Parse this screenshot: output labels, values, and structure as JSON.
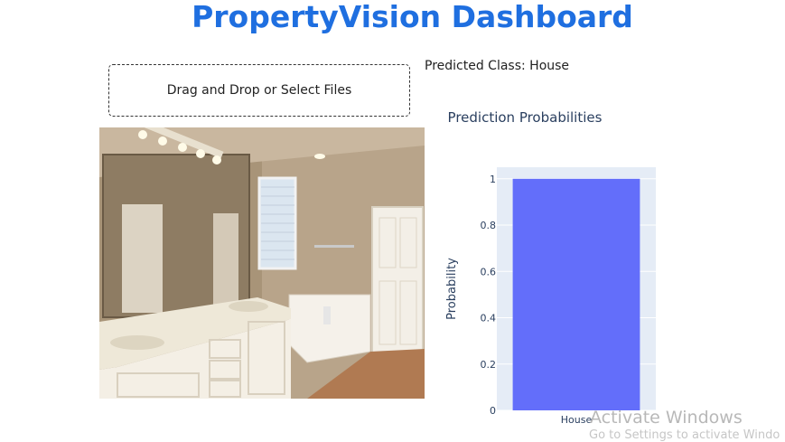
{
  "app": {
    "title": "PropertyVision Dashboard"
  },
  "upload": {
    "label": "Drag and Drop or Select Files"
  },
  "prediction": {
    "text": "Predicted Class: House"
  },
  "image": {
    "subject": "bathroom-photo"
  },
  "chart_data": {
    "type": "bar",
    "title": "Prediction Probabilities",
    "xlabel": "",
    "ylabel": "Probability",
    "categories": [
      "House"
    ],
    "values": [
      1
    ],
    "ylim": [
      0,
      1.05
    ],
    "yticks": [
      "0",
      "0.2",
      "0.4",
      "0.6",
      "0.8",
      "1"
    ],
    "bar_color": "#636efa",
    "plot_background": "#e5ecf6",
    "grid": true,
    "legend": "none"
  },
  "watermark": {
    "line1": "Activate Windows",
    "line2": "Go to Settings to activate Windo"
  }
}
